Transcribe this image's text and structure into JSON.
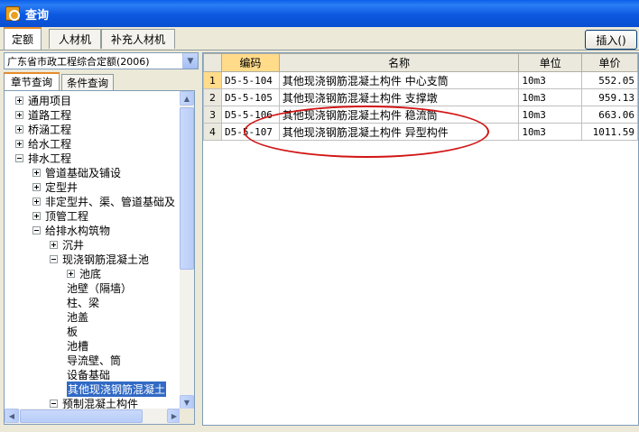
{
  "window": {
    "title": "查询"
  },
  "tabs": [
    {
      "label": "定额"
    },
    {
      "label": "人材机"
    },
    {
      "label": "补充人材机"
    }
  ],
  "toolbar": {
    "insert_label": "插入()"
  },
  "quota_library": {
    "selected": "广东省市政工程综合定额(2006)"
  },
  "search_tabs": [
    {
      "label": "章节查询"
    },
    {
      "label": "条件查询"
    }
  ],
  "tree": [
    {
      "label": "通用项目",
      "depth": 0,
      "expander": "plus"
    },
    {
      "label": "道路工程",
      "depth": 0,
      "expander": "plus"
    },
    {
      "label": "桥涵工程",
      "depth": 0,
      "expander": "plus"
    },
    {
      "label": "给水工程",
      "depth": 0,
      "expander": "plus"
    },
    {
      "label": "排水工程",
      "depth": 0,
      "expander": "minus"
    },
    {
      "label": "管道基础及铺设",
      "depth": 1,
      "expander": "plus"
    },
    {
      "label": "定型井",
      "depth": 1,
      "expander": "plus"
    },
    {
      "label": "非定型井、渠、管道基础及",
      "depth": 1,
      "expander": "plus"
    },
    {
      "label": "顶管工程",
      "depth": 1,
      "expander": "plus"
    },
    {
      "label": "给排水构筑物",
      "depth": 1,
      "expander": "minus"
    },
    {
      "label": "沉井",
      "depth": 2,
      "expander": "plus"
    },
    {
      "label": "现浇钢筋混凝土池",
      "depth": 2,
      "expander": "minus"
    },
    {
      "label": "池底",
      "depth": 3,
      "expander": "plus"
    },
    {
      "label": "池壁（隔墙）",
      "depth": 3,
      "expander": "none"
    },
    {
      "label": "柱、梁",
      "depth": 3,
      "expander": "none"
    },
    {
      "label": "池盖",
      "depth": 3,
      "expander": "none"
    },
    {
      "label": "板",
      "depth": 3,
      "expander": "none"
    },
    {
      "label": "池槽",
      "depth": 3,
      "expander": "none"
    },
    {
      "label": "导流壁、筒",
      "depth": 3,
      "expander": "none"
    },
    {
      "label": "设备基础",
      "depth": 3,
      "expander": "none"
    },
    {
      "label": "其他现浇钢筋混凝土",
      "depth": 3,
      "expander": "none",
      "selected": true
    },
    {
      "label": "预制混凝土构件",
      "depth": 2,
      "expander": "minus"
    }
  ],
  "grid": {
    "columns": [
      "编码",
      "名称",
      "单位",
      "单价"
    ],
    "rows": [
      {
        "index": "1",
        "code": "D5-5-104",
        "name": "其他现浇钢筋混凝土构件 中心支筒",
        "unit": "10m3",
        "price": "552.05"
      },
      {
        "index": "2",
        "code": "D5-5-105",
        "name": "其他现浇钢筋混凝土构件 支撑墩",
        "unit": "10m3",
        "price": "959.13"
      },
      {
        "index": "3",
        "code": "D5-5-106",
        "name": "其他现浇钢筋混凝土构件 稳流筒",
        "unit": "10m3",
        "price": "663.06"
      },
      {
        "index": "4",
        "code": "D5-5-107",
        "name": "其他现浇钢筋混凝土构件 异型构件",
        "unit": "10m3",
        "price": "1011.59"
      }
    ]
  },
  "colors": {
    "title_bar": "#0a5fe8",
    "selection": "#316ac5",
    "annotation": "#d21414",
    "tab_accent": "#e68b2c"
  }
}
